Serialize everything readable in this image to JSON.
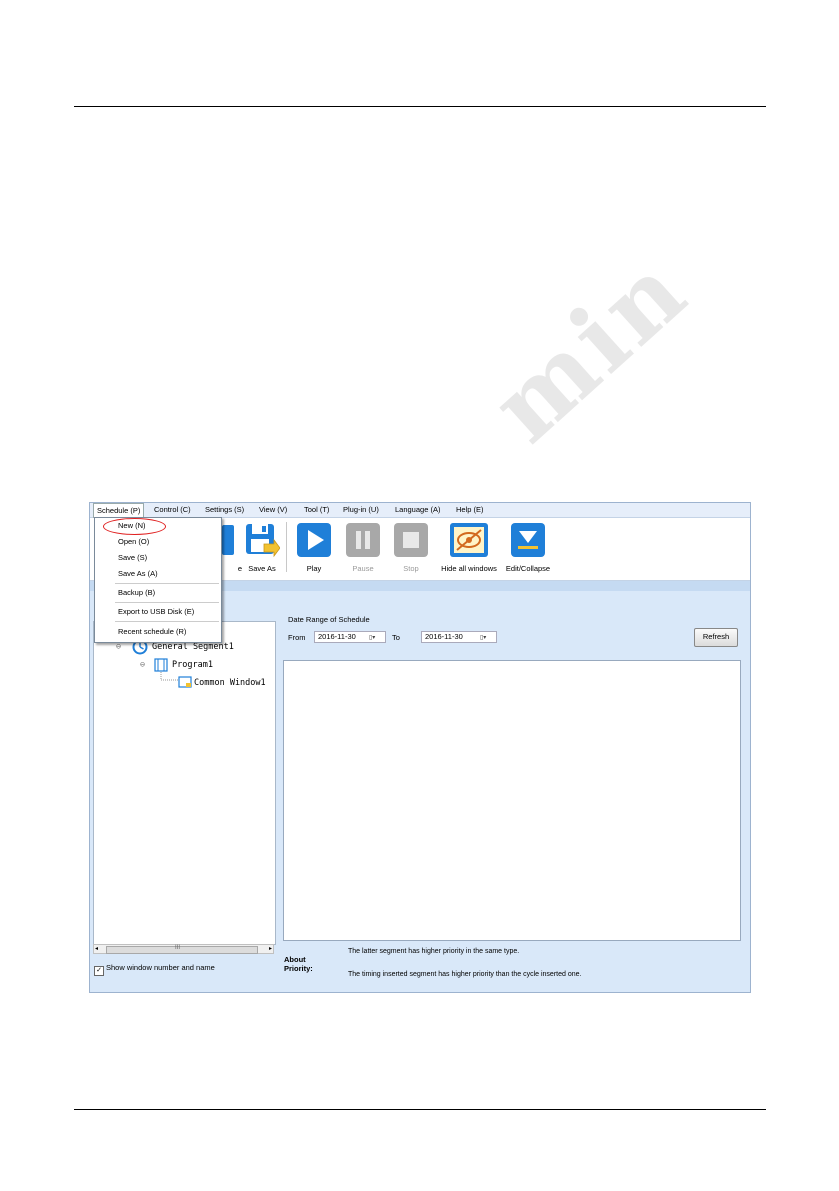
{
  "watermark": "min",
  "menubar": {
    "items": [
      "Schedule (P)",
      "Control (C)",
      "Settings (S)",
      "View (V)",
      "Tool (T)",
      "Plug-in (U)",
      "Language (A)",
      "Help (E)"
    ]
  },
  "schedule_menu": {
    "items": [
      "New (N)",
      "Open (O)",
      "Save (S)",
      "Save As (A)",
      "Backup (B)",
      "Export to USB Disk (E)",
      "Recent schedule (R)"
    ]
  },
  "toolbar": {
    "partial_label": "e",
    "save_as": "Save As",
    "play": "Play",
    "pause": "Pause",
    "stop": "Stop",
    "hide_all": "Hide all windows",
    "edit_collapse": "Edit/Collapse"
  },
  "tree": {
    "segment": "General Segment1",
    "program": "Program1",
    "window": "Common Window1"
  },
  "scrollbar_grip": "III",
  "show_window_label": "Show window number and name",
  "date_range": {
    "title": "Date Range of Schedule",
    "from_label": "From",
    "from_value": "2016-11-30",
    "to_label": "To",
    "to_value": "2016-11-30",
    "refresh": "Refresh"
  },
  "about": {
    "label": "About Priority:",
    "note1": "The latter segment has higher priority in the same type.",
    "note2": "The timing inserted segment has higher priority than the cycle inserted one."
  },
  "colors": {
    "accent_blue": "#1f7fd8",
    "annotation_red": "#e02020",
    "disabled_gray": "#9a9a9a"
  }
}
